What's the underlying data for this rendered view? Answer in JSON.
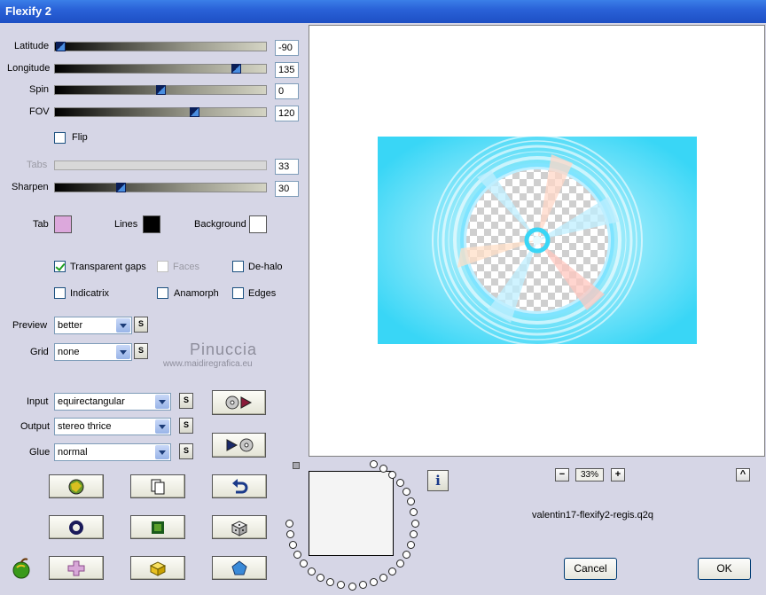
{
  "window": {
    "title": "Flexify 2"
  },
  "sliders": [
    {
      "id": "latitude",
      "label": "Latitude",
      "value": "-90",
      "fraction": 0.02
    },
    {
      "id": "longitude",
      "label": "Longitude",
      "value": "135",
      "fraction": 0.85
    },
    {
      "id": "spin",
      "label": "Spin",
      "value": "0",
      "fraction": 0.5
    },
    {
      "id": "fov",
      "label": "FOV",
      "value": "120",
      "fraction": 0.67
    },
    {
      "id": "tabs",
      "label": "Tabs",
      "value": "33",
      "disabled": true
    },
    {
      "id": "sharpen",
      "label": "Sharpen",
      "value": "30",
      "fraction": 0.3
    }
  ],
  "flip": {
    "label": "Flip",
    "checked": false
  },
  "colors": {
    "tab": {
      "label": "Tab",
      "color": "#dca8dc"
    },
    "lines": {
      "label": "Lines",
      "color": "#000000"
    },
    "background": {
      "label": "Background",
      "color": "#ffffff"
    }
  },
  "checkboxes": {
    "transparent_gaps": {
      "label": "Transparent gaps",
      "checked": true
    },
    "faces": {
      "label": "Faces",
      "checked": false,
      "disabled": true
    },
    "de_halo": {
      "label": "De-halo",
      "checked": false
    },
    "indicatrix": {
      "label": "Indicatrix",
      "checked": false
    },
    "anamorph": {
      "label": "Anamorph",
      "checked": false
    },
    "edges": {
      "label": "Edges",
      "checked": false
    }
  },
  "selects": {
    "preview": {
      "label": "Preview",
      "value": "better"
    },
    "grid": {
      "label": "Grid",
      "value": "none"
    },
    "input": {
      "label": "Input",
      "value": "equirectangular"
    },
    "output": {
      "label": "Output",
      "value": "stereo thrice"
    },
    "glue": {
      "label": "Glue",
      "value": "normal"
    }
  },
  "small_button_label": "S",
  "watermark": {
    "name": "Pinuccia",
    "url": "www.maidiregrafica.eu"
  },
  "zoom": {
    "minus": "−",
    "value": "33%",
    "plus": "+"
  },
  "info_label": "i",
  "caret_label": "^",
  "filename": "valentin17-flexify2-regis.q2q",
  "buttons": {
    "cancel": "Cancel",
    "ok": "OK"
  },
  "accent_colors": {
    "title_bar": "#2a62d8",
    "preview_cyan": "#39d6f6"
  }
}
